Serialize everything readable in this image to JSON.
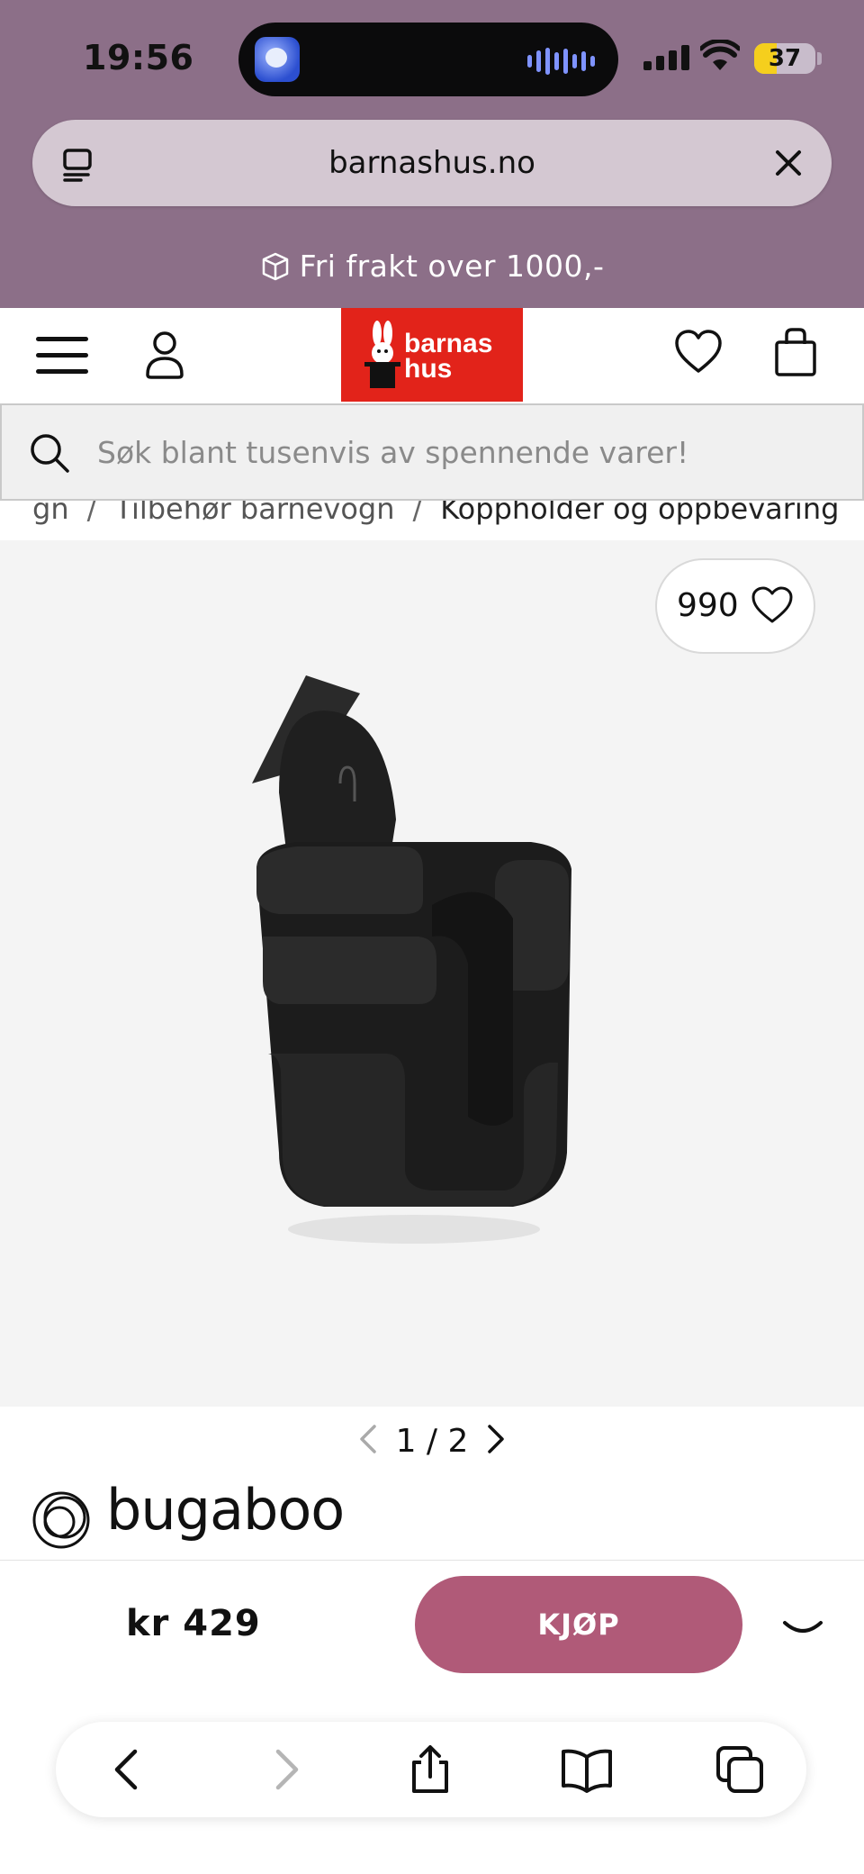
{
  "status_bar": {
    "time": "19:56",
    "battery": "37",
    "battery_level": 0.37,
    "icons": [
      "moon-app-icon",
      "audio-wave-icon",
      "cellular-signal-icon",
      "wifi-icon",
      "battery-icon"
    ]
  },
  "browser": {
    "url": "barnashus.no",
    "icons": [
      "page-menu-icon",
      "close-icon"
    ]
  },
  "promo": {
    "text": "Fri frakt over 1000,-",
    "icon": "box-icon"
  },
  "header": {
    "logo_line1": "barnas",
    "logo_line2": "hus",
    "logo_color": "#e2231a",
    "icons": [
      "menu-icon",
      "user-icon",
      "heart-icon",
      "bag-icon"
    ]
  },
  "search": {
    "placeholder": "Søk blant tusenvis av spennende varer!"
  },
  "breadcrumb": {
    "items": [
      "gn",
      "Tilbehør barnevogn",
      "Koppholder og oppbevaring"
    ]
  },
  "product": {
    "wishlist_count": "990",
    "image_alt": "cup holder product image",
    "pager_current": "1",
    "pager_sep": "/",
    "pager_total": "2",
    "brand": "bugaboo",
    "price": "kr 429",
    "buy_label": "KJØP",
    "buy_color": "#b05a78"
  },
  "toolbar": {
    "icons": [
      "back-icon",
      "forward-icon",
      "share-icon",
      "bookmarks-icon",
      "tabs-icon"
    ]
  }
}
